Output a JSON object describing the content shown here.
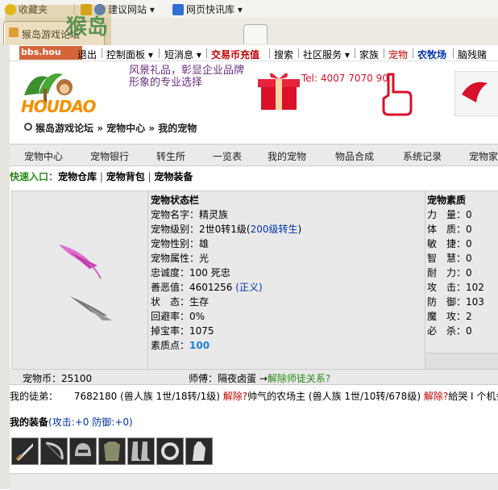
{
  "browser": {
    "favorites": {
      "label": "收藏夹"
    },
    "fav_links": [
      {
        "label": "建议网站 ▾"
      },
      {
        "label": "网页快讯库 ▾"
      }
    ],
    "tab_title": "猴岛游戏论坛",
    "watermark": "bbs.hou"
  },
  "topnav": {
    "items": [
      {
        "label": "退出"
      },
      {
        "label": "控制面板 ▾"
      },
      {
        "label": "短消息 ▾"
      },
      {
        "label": "交易币充值"
      },
      {
        "label": "搜索"
      },
      {
        "label": "社区服务 ▾"
      },
      {
        "label": "家族"
      },
      {
        "label": "宠物"
      },
      {
        "label": "农牧场"
      },
      {
        "label": "脑残赌"
      }
    ]
  },
  "banner": {
    "logo_text": "HOUDAO",
    "ad_text": "风景礼品，彰显企业品牌形象的专业选择",
    "phone": "Tel: 4007 7070 90"
  },
  "breadcrumb": {
    "items": [
      "猴岛游戏论坛",
      "宠物中心",
      "我的宠物"
    ]
  },
  "menu": {
    "items": [
      "宠物中心",
      "宠物银行",
      "转生所",
      "一览表",
      "我的宠物",
      "物品合成",
      "系统记录",
      "宠物家"
    ]
  },
  "quick": {
    "label": "快速入口：",
    "links": [
      "宠物仓库",
      "宠物背包",
      "宠物装备"
    ]
  },
  "pet_status": {
    "heading": "宠物状态栏",
    "name": "宠物名字：精灵族",
    "level_prefix": "宠物级别：2世0转1级(",
    "level_link": "200级转生",
    "level_suffix": ")",
    "gender": "宠物性别：雄",
    "element": "宠物属性：光",
    "loyalty": "忠诚度：100 死忠",
    "morality_prefix": "善恶值：4601256 ",
    "morality_link": "(正义)",
    "state": "状　态：生存",
    "evasion": "回避率：0%",
    "drop": "掉宝率：1075",
    "quality_label": "素质点：",
    "quality_value": "100"
  },
  "pet_attributes": {
    "heading": "宠物素质",
    "rows": [
      {
        "k": "力　量",
        "v": "0"
      },
      {
        "k": "体　质",
        "v": "0"
      },
      {
        "k": "敏　捷",
        "v": "0"
      },
      {
        "k": "智　慧",
        "v": "0"
      },
      {
        "k": "耐　力",
        "v": "0"
      },
      {
        "k": "攻　击",
        "v": "102"
      },
      {
        "k": "防　御",
        "v": "103"
      },
      {
        "k": "魔　攻",
        "v": "2"
      },
      {
        "k": "必　杀",
        "v": "0"
      }
    ]
  },
  "money": {
    "coins": "宠物币：25100",
    "master_prefix": "师傅：隔夜卤蛋 →",
    "master_link": "解除师徒关系?"
  },
  "apprentice": {
    "label": "我的徒弟：",
    "entry1": "7682180 (兽人族 1世/18转/1级)",
    "remove1": "解除?",
    "entry2": "帅气的农场主 (兽人族 1世/10转/678级)",
    "remove2": "解除?",
    "entry3": "給哭 I 个机会"
  },
  "equipment": {
    "label": "我的装备",
    "stats": "(攻击:+0 防御:+0)",
    "icons": [
      "sword-icon",
      "bow-icon",
      "helmet-icon",
      "armor-icon",
      "boots-icon",
      "ring-icon",
      "gauntlet-icon"
    ]
  }
}
